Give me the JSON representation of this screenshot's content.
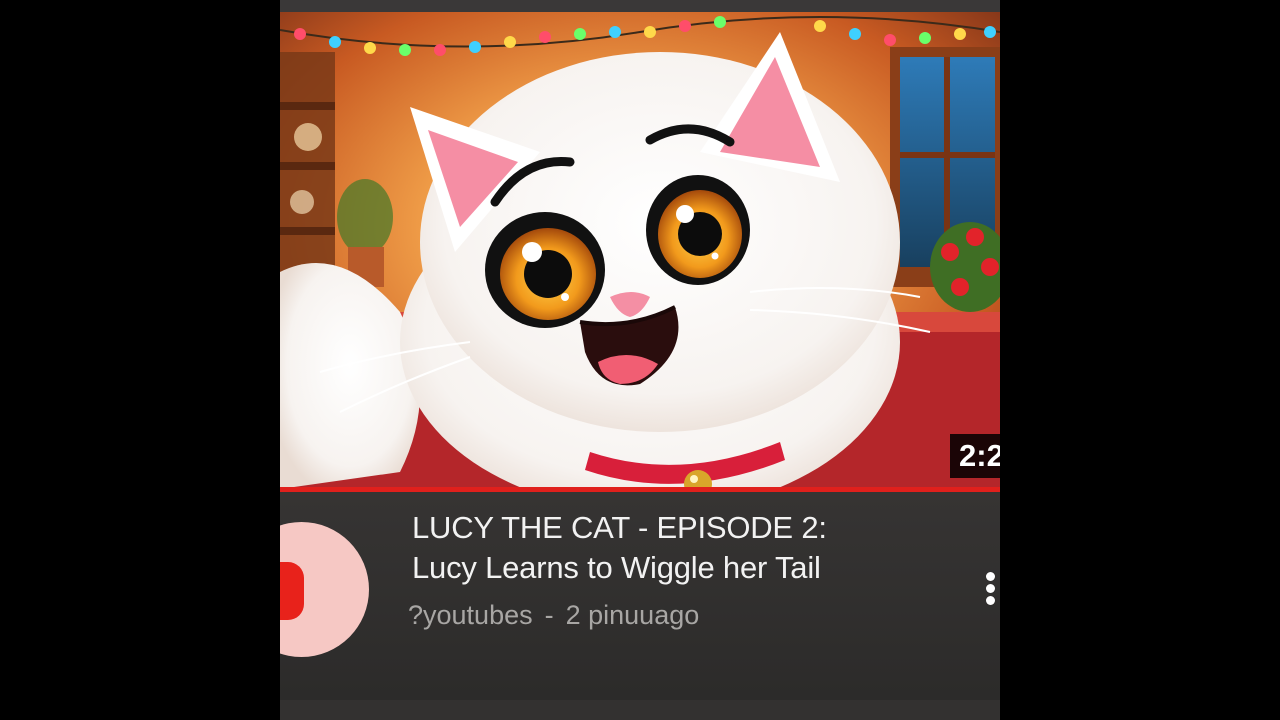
{
  "video": {
    "duration": "2:2",
    "progress_fraction": 1.0,
    "title_line1": "LUCY THE CAT - EPISODE 2:",
    "title_line2": "Lucy Learns to Wiggle her Tail",
    "channel": "?youtubes",
    "separator": "-",
    "age": "2 pinuuago"
  },
  "icons": {
    "channel_avatar": "youtube-logo-icon",
    "menu": "more-vertical-icon"
  },
  "colors": {
    "progress": "#e0201c",
    "logo_red": "#e8221b",
    "avatar_bg": "#f6c8c4",
    "page_bg": "#000000",
    "card_bg": "#2e2c2b"
  }
}
